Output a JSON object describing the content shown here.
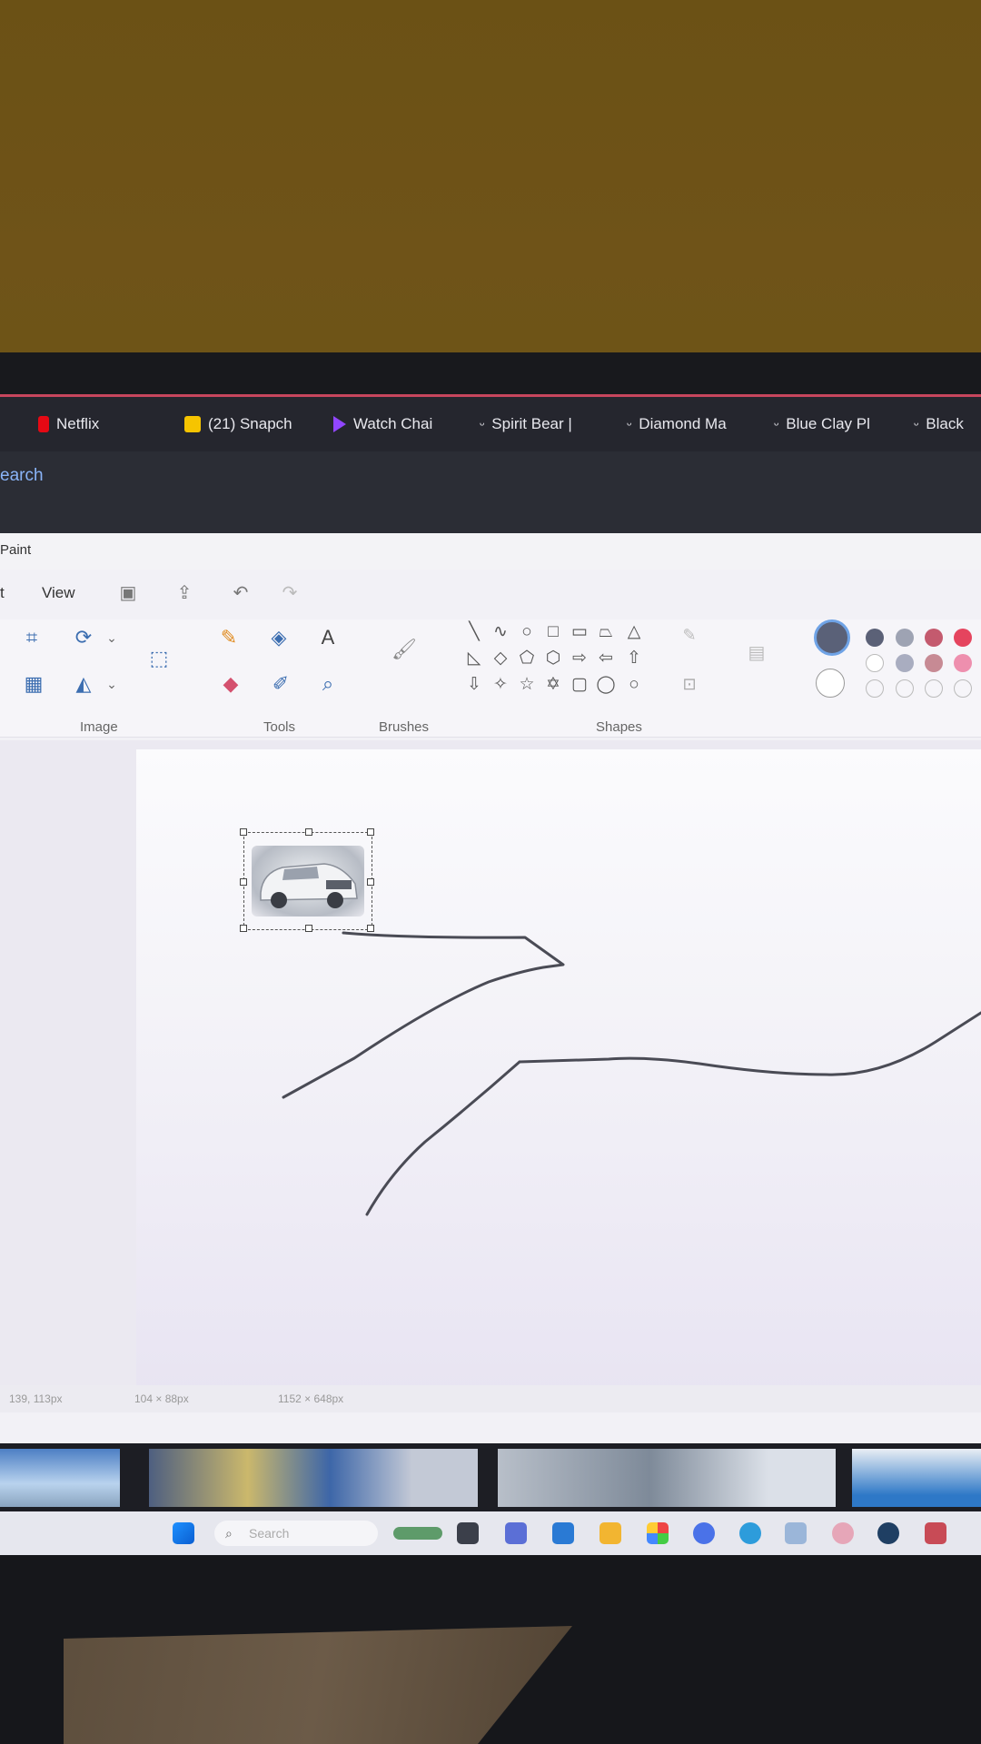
{
  "browser": {
    "bookmarks": [
      {
        "label": "Netflix",
        "icon": "netflix-icon",
        "color": "#e50914"
      },
      {
        "label": "(21) Snapch",
        "icon": "snapchat-icon",
        "color": "#fffc00"
      },
      {
        "label": "Watch Chai",
        "icon": "twitch-icon",
        "color": "#9146ff"
      },
      {
        "label": "Spirit Bear |",
        "icon": "bookmark-icon",
        "color": "#e8e8ee"
      },
      {
        "label": "Diamond Ma",
        "icon": "bookmark-icon",
        "color": "#e8e8ee"
      },
      {
        "label": "Blue Clay Pl",
        "icon": "bookmark-icon",
        "color": "#e8e8ee"
      },
      {
        "label": "Black",
        "icon": "bookmark-icon",
        "color": "#e8e8ee"
      }
    ],
    "search_fragment": "earch"
  },
  "paint": {
    "app_title": "Paint",
    "menu": {
      "partial_label": "t",
      "view_label": "View"
    },
    "groups": {
      "image": "Image",
      "tools": "Tools",
      "brushes": "Brushes",
      "shapes": "Shapes"
    },
    "colors": {
      "current_primary": "#5a6178",
      "palette_row1": [
        "#5b6177",
        "#9ea3b3",
        "#c45a6e",
        "#e5445e"
      ],
      "palette_row2": [
        "#ffffff",
        "#a9adc0",
        "#c78a94",
        "#ee8fae"
      ]
    },
    "status": {
      "cursor": "139, 113px",
      "selection": "104 × 88px",
      "canvas_size": "1152 × 648px"
    }
  },
  "taskbar": {
    "search_placeholder": "Search"
  }
}
